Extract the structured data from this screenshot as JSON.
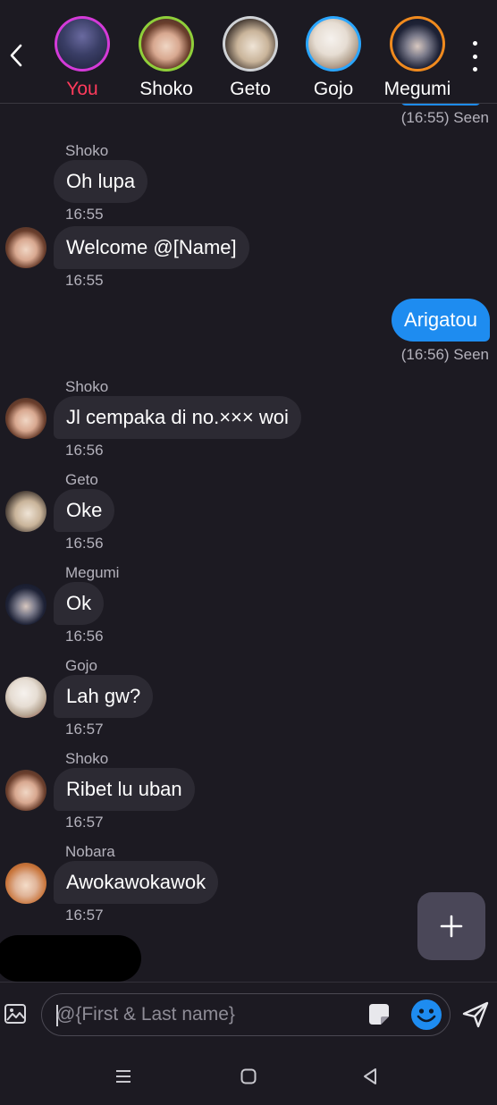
{
  "header": {
    "participants": [
      {
        "name": "You"
      },
      {
        "name": "Shoko"
      },
      {
        "name": "Geto"
      },
      {
        "name": "Gojo"
      },
      {
        "name": "Megumi"
      }
    ]
  },
  "chat": {
    "top_seen": "(16:55) Seen",
    "messages": [
      {
        "sender": "Shoko",
        "text": "Oh lupa",
        "time": "16:55"
      },
      {
        "text": "Welcome @[Name]",
        "time": "16:55"
      },
      {
        "text": "Arigatou",
        "status": "(16:56) Seen",
        "mine": true
      },
      {
        "sender": "Shoko",
        "text": "Jl cempaka di no.××× woi",
        "time": "16:56"
      },
      {
        "sender": "Geto",
        "text": "Oke",
        "time": "16:56"
      },
      {
        "sender": "Megumi",
        "text": "Ok",
        "time": "16:56"
      },
      {
        "sender": "Gojo",
        "text": "Lah gw?",
        "time": "16:57"
      },
      {
        "sender": "Shoko",
        "text": "Ribet lu uban",
        "time": "16:57"
      },
      {
        "sender": "Nobara",
        "text": "Awokawokawok",
        "time": "16:57"
      }
    ]
  },
  "composer": {
    "placeholder": "@{First & Last name}"
  },
  "icons": {
    "back": "chevron-left-icon",
    "more": "more-vertical-icon",
    "add": "plus-icon",
    "gallery": "image-icon",
    "sticker": "sticker-icon",
    "emoji": "emoji-icon",
    "send": "send-icon"
  },
  "colors": {
    "background": "#1c1a22",
    "incoming_bubble": "#2c2a33",
    "outgoing_bubble": "#1e8cf0",
    "you_label": "#ff3b5c",
    "emoji_accent": "#1e8cf0"
  }
}
